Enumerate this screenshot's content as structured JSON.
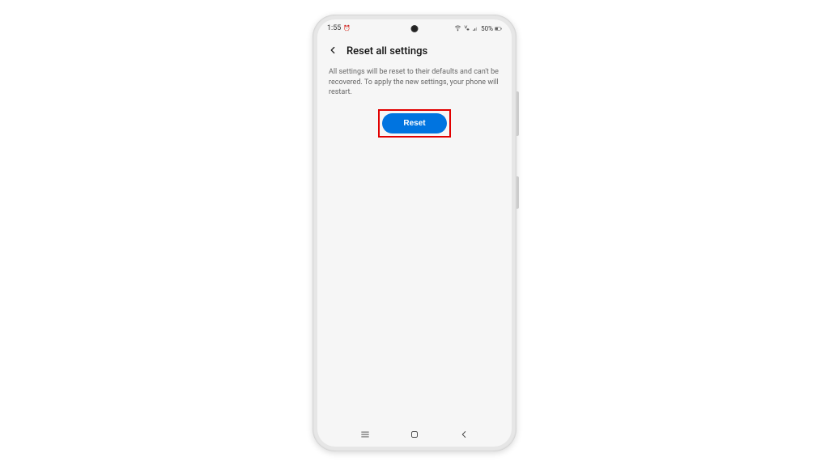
{
  "status": {
    "time": "1:55",
    "alarm_indicator": "⏱",
    "battery_text": "50%"
  },
  "header": {
    "title": "Reset all settings"
  },
  "content": {
    "description": "All settings will be reset to their defaults and can't be recovered. To apply the new settings, your phone will restart.",
    "reset_label": "Reset"
  },
  "colors": {
    "accent": "#0074e0",
    "highlight": "#e20000"
  }
}
